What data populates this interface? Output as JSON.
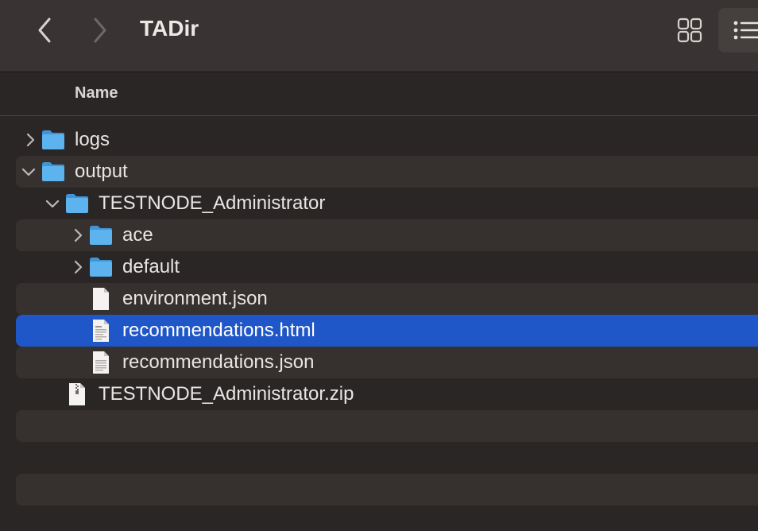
{
  "window": {
    "title": "TADir"
  },
  "toolbar": {
    "back_icon": "chevron-left-icon",
    "forward_icon": "chevron-right-icon",
    "grid_view_icon": "grid-view-icon",
    "list_view_icon": "list-view-icon"
  },
  "columns": {
    "name": "Name"
  },
  "items": [
    {
      "label": "logs",
      "kind": "folder",
      "expanded": false,
      "level": 0
    },
    {
      "label": "output",
      "kind": "folder",
      "expanded": true,
      "level": 0
    },
    {
      "label": "TESTNODE_Administrator",
      "kind": "folder",
      "expanded": true,
      "level": 1
    },
    {
      "label": "ace",
      "kind": "folder",
      "expanded": false,
      "level": 2
    },
    {
      "label": "default",
      "kind": "folder",
      "expanded": false,
      "level": 2
    },
    {
      "label": "environment.json",
      "kind": "file",
      "level": 2
    },
    {
      "label": "recommendations.html",
      "kind": "html-file",
      "level": 2,
      "selected": true
    },
    {
      "label": "recommendations.json",
      "kind": "json-file",
      "level": 2
    },
    {
      "label": "TESTNODE_Administrator.zip",
      "kind": "zip-file",
      "level": 1
    }
  ],
  "colors": {
    "selection": "#2057c8",
    "folder": "#5cb3ee",
    "background": "#2a2625",
    "toolbar": "#393433"
  }
}
